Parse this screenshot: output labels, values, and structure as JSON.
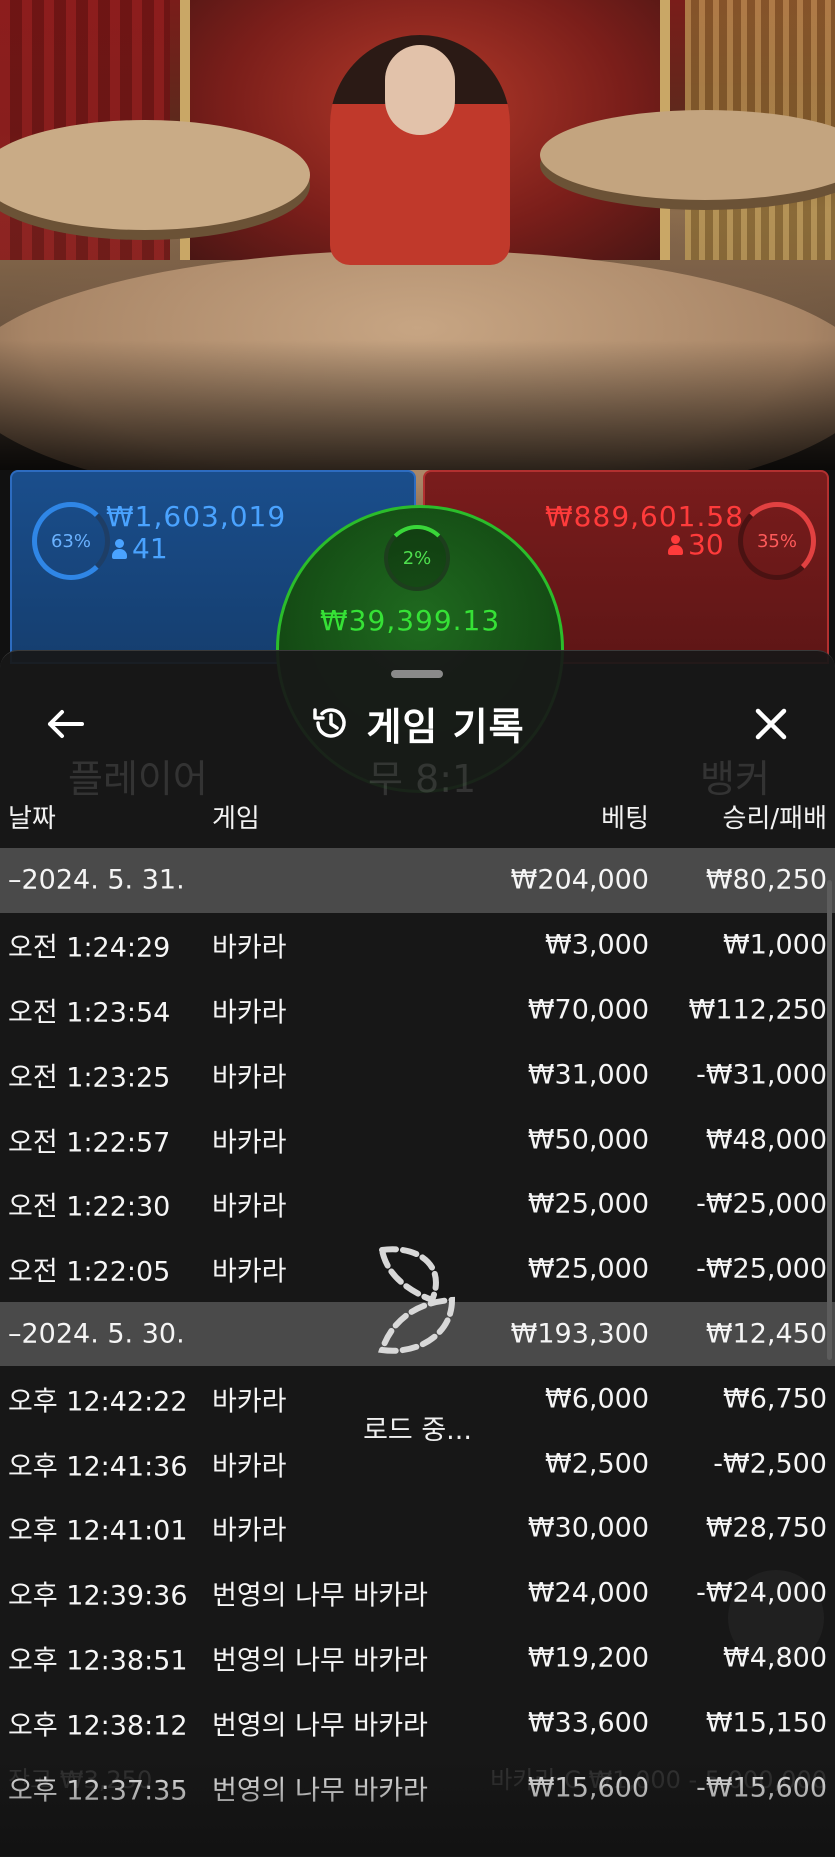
{
  "betting": {
    "player": {
      "percent": "63%",
      "amount": "₩1,603,019",
      "count": "41",
      "color": "#2f86e6"
    },
    "banker": {
      "percent": "35%",
      "amount": "₩889,601.58",
      "count": "30",
      "color": "#e24141"
    },
    "tie": {
      "percent": "2%",
      "amount": "₩39,399.13",
      "color": "#36e136"
    }
  },
  "sheet": {
    "title": "게임 기록",
    "icons": {
      "back": "arrow-left-icon",
      "history": "history-icon",
      "close": "close-icon"
    },
    "columns": {
      "date": "날짜",
      "game": "게임",
      "bet": "베팅",
      "result": "승리/패배"
    },
    "days": [
      {
        "date": "–2024. 5. 31.",
        "bet": "₩204,000",
        "result": "₩80,250",
        "rows": [
          {
            "time": "오전 1:24:29",
            "game": "바카라",
            "bet": "₩3,000",
            "result": "₩1,000"
          },
          {
            "time": "오전 1:23:54",
            "game": "바카라",
            "bet": "₩70,000",
            "result": "₩112,250"
          },
          {
            "time": "오전 1:23:25",
            "game": "바카라",
            "bet": "₩31,000",
            "result": "-₩31,000"
          },
          {
            "time": "오전 1:22:57",
            "game": "바카라",
            "bet": "₩50,000",
            "result": "₩48,000"
          },
          {
            "time": "오전 1:22:30",
            "game": "바카라",
            "bet": "₩25,000",
            "result": "-₩25,000"
          },
          {
            "time": "오전 1:22:05",
            "game": "바카라",
            "bet": "₩25,000",
            "result": "-₩25,000"
          }
        ]
      },
      {
        "date": "–2024. 5. 30.",
        "bet": "₩193,300",
        "result": "₩12,450",
        "rows": [
          {
            "time": "오후 12:42:22",
            "game": "바카라",
            "bet": "₩6,000",
            "result": "₩6,750"
          },
          {
            "time": "오후 12:41:36",
            "game": "바카라",
            "bet": "₩2,500",
            "result": "-₩2,500"
          },
          {
            "time": "오후 12:41:01",
            "game": "바카라",
            "bet": "₩30,000",
            "result": "₩28,750"
          },
          {
            "time": "오후 12:39:36",
            "game": "번영의 나무 바카라",
            "bet": "₩24,000",
            "result": "-₩24,000"
          },
          {
            "time": "오후 12:38:51",
            "game": "번영의 나무 바카라",
            "bet": "₩19,200",
            "result": "₩4,800"
          },
          {
            "time": "오후 12:38:12",
            "game": "번영의 나무 바카라",
            "bet": "₩33,600",
            "result": "₩15,150"
          },
          {
            "time": "오후 12:37:35",
            "game": "번영의 나무 바카라",
            "bet": "₩15,600",
            "result": "-₩15,600"
          }
        ]
      }
    ],
    "loading_text": "로드 중..."
  },
  "background_ghost": {
    "player_label": "플레이어",
    "tie_label": "무 8:1",
    "banker_label": "뱅커",
    "balance": "잔고 ₩3,250",
    "limits": "바카라 C ₩1,000 - 5,000,000"
  }
}
